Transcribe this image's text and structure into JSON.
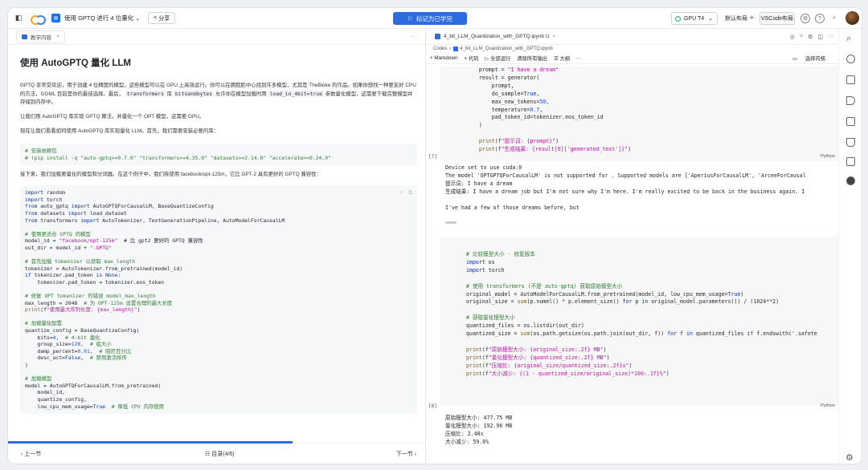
{
  "topbar": {
    "title": "使用 GPTQ 进行 4 位量化",
    "title_chevron": "⌄",
    "share": "分享",
    "mark_learned": "标记为已学完",
    "gpu": "GPU T4",
    "gpu_chevron": "⌄",
    "layout": "默认布局",
    "vscode": "VSCode布局"
  },
  "left": {
    "tab": "教学内容",
    "heading": "使用 AutoGPTQ 量化 LLM",
    "p1": [
      "GPTQ 非常受欢迎，用于创建 4 位精度的模型，这些模型可以在 GPU 上高效运行。你可以在拥抱脸中心找到许多模型，尤其是 TheBloke 的作品。如果你想找一种更友好 CPU 的方法，GGML 目前是你的最佳选择。最后，",
      "transformers",
      "库",
      "bitsandbytes",
      "允许你在模型加载时用",
      "load_in_4bit=true",
      "参数量化模型，这需要下载完整模型并存储到内存中。"
    ],
    "p2": "让我们用 AutoGPTQ 库实现 GPTQ 算法，并量化一个 OPT 模型，这需要 GPU。",
    "p3": "现在让我们看看如何使用 AutoGPTQ 库实现量化 LLM。首先，我们需要安装必要的库：",
    "code1": [
      "# 安装依赖包",
      "# !pip install -q \"auto-gptq>=0.7.0\" \"transformers>=4.35.0\" \"datasets>=2.14.0\" \"accelerate>=0.24.0\""
    ],
    "p4": "接下来，我们加载要量化的模型和分词器。在这个例子中，我们将使用 facebook/opt-125m，它比 GPT-2 具有更好的 GPTQ 兼容性：",
    "code2": [
      "import random",
      "import torch",
      "from auto_gptq import AutoGPTQForCausalLM, BaseQuantizeConfig",
      "from datasets import load_dataset",
      "from transformers import AutoTokenizer, TextGenerationPipeline, AutoModelForCausalLM",
      "",
      "# 使用更适合 GPTQ 的模型",
      "model_id = \"facebook/opt-125m\"  # 比 gpt2 更好的 GPTQ 兼容性",
      "out_dir = model_id + \"-GPTQ\"",
      "",
      "# 首先加载 tokenizer 以获取 max_length",
      "tokenizer = AutoTokenizer.from_pretrained(model_id)",
      "if tokenizer.pad_token is None:",
      "    tokenizer.pad_token = tokenizer.eos_token",
      "",
      "# 修复 OPT tokenizer 的错误 model_max_length",
      "max_length = 2048  # 为 OPT-125m 设置合理的最大长度",
      "print(f\"使用最大序列长度: {max_length}\")",
      "",
      "# 加载量化配置",
      "quantize_config = BaseQuantizeConfig(",
      "    bits=4,  # 4-bit 量化",
      "    group_size=128,  # 组大小",
      "    damp_percent=0.01,  # 阻尼百分比",
      "    desc_act=False,  # 禁用激活排序",
      ")",
      "",
      "# 加载模型",
      "model = AutoGPTQForCausalLM.from_pretrained(",
      "    model_id,",
      "    quantize_config,",
      "    low_cpu_mem_usage=True  # 降低 CPU 内存使用"
    ],
    "prev": "上一节",
    "toc": "目录(4/6)",
    "next": "下一节",
    "progress": 0.68
  },
  "right": {
    "tab": "4_bit_LLM_Quantization_with_GPTQ.ipynb U",
    "crumb": [
      "Codes",
      "4_bit_LLM_Quantization_with_GPTQ.ipynb"
    ],
    "toolbar": [
      "+ Markdown",
      "+ 代码",
      "▷ 全部运行",
      "清除所有输出",
      "☰ 大纲",
      "···"
    ],
    "kernel": "选择内核",
    "cell7": [
      "    prompt = \"I have a dream\"",
      "    result = generator(",
      "        prompt,",
      "        do_sample=True,",
      "        max_new_tokens=50,",
      "        temperature=0.7,",
      "        pad_token_id=tokenizer.eos_token_id",
      "    )",
      "",
      "    print(f\"提示词: {prompt}\")",
      "    print(f\"生成结果: {result[0]['generated_text']}\")"
    ],
    "cell7_no": "[7]",
    "lang": "Python",
    "out7": [
      "Device set to use cuda:0",
      "The model 'OPTGPTQForCausalLM' is not supported for . Supported models are ['AperiusForCausalLM', 'ArceeForCausal",
      "提示词: I have a dream",
      "生成结果: I have a dream job but I'm not sure why I'm here. I'm really excited to be back in the business again. I",
      "",
      "I've had a few of those dreams before, but"
    ],
    "cell8": [
      "# 比较模型大小 - 修复版本",
      "import os",
      "import torch",
      "",
      "# 使用 transformers (不是 auto-gptq) 获取原始模型大小",
      "original_model = AutoModelForCausalLM.from_pretrained(model_id, low_cpu_mem_usage=True)",
      "original_size = sum(p.numel() * p.element_size() for p in original_model.parameters()) / (1024**2)",
      "",
      "# 获取量化模型大小",
      "quantized_files = os.listdir(out_dir)",
      "quantized_size = sum(os.path.getsize(os.path.join(out_dir, f)) for f in quantized_files if f.endswith('.safete",
      "",
      "print(f\"原始模型大小: {original_size:.2f} MB\")",
      "print(f\"量化模型大小: {quantized_size:.2f} MB\")",
      "print(f\"压缩比: {original_size/quantized_size:.2f}x\")",
      "print(f\"大小减少: {(1 - quantized_size/original_size)*100:.1f}%\")"
    ],
    "cell8_no": "[8]",
    "out8": [
      "原始模型大小: 477.75 MB",
      "量化模型大小: 192.96 MB",
      "压缩比: 2.48x",
      "大小减少: 59.6%"
    ]
  }
}
